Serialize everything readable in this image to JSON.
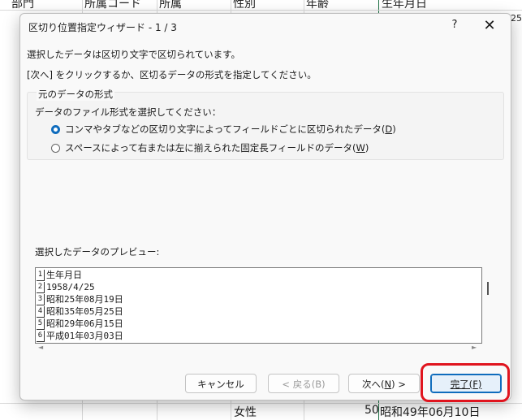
{
  "sheet": {
    "top_headers": [
      "部門",
      "所属コード",
      "所属",
      "性別",
      "年齢",
      "生年月日"
    ],
    "right_edge_fragment": "25",
    "bottom_row": {
      "gender": "女性",
      "age": "50",
      "birthdate": "昭和49年06月10日"
    },
    "accent_color": "#1e7145"
  },
  "dialog": {
    "title": "区切り位置指定ウィザード - 1 / 3",
    "help_glyph": "?",
    "close_glyph": "✕",
    "intro_line1": "選択したデータは区切り文字で区切られています。",
    "intro_line2": "[次へ] をクリックするか、区切るデータの形式を指定してください。",
    "group": {
      "title": "元のデータの形式",
      "prompt": "データのファイル形式を選択してください：",
      "options": [
        {
          "text": "コンマやタブなどの区切り文字によってフィールドごとに区切られたデータ(",
          "key": "D",
          "suffix": ")",
          "checked": true
        },
        {
          "text": "スペースによって右または左に揃えられた固定長フィールドのデータ(",
          "key": "W",
          "suffix": ")",
          "checked": false
        }
      ]
    },
    "preview": {
      "label": "選択したデータのプレビュー:",
      "rows": [
        {
          "num": "1",
          "text": "生年月日"
        },
        {
          "num": "2",
          "text": "1958/4/25"
        },
        {
          "num": "3",
          "text": "昭和25年08月19日"
        },
        {
          "num": "4",
          "text": "昭和35年05月25日"
        },
        {
          "num": "5",
          "text": "昭和29年06月15日"
        },
        {
          "num": "6",
          "text": "平成01年03月03日"
        }
      ],
      "scroll_left": "◄",
      "scroll_right": "►"
    },
    "buttons": {
      "cancel": "キャンセル",
      "back": "< 戻る(B)",
      "next_pre": "次へ(",
      "next_key": "N",
      "next_post": ") >",
      "finish_pre": "完了(",
      "finish_key": "F",
      "finish_post": ")"
    },
    "primary_color": "#0f6cbd",
    "highlight_color": "#e0141e"
  }
}
